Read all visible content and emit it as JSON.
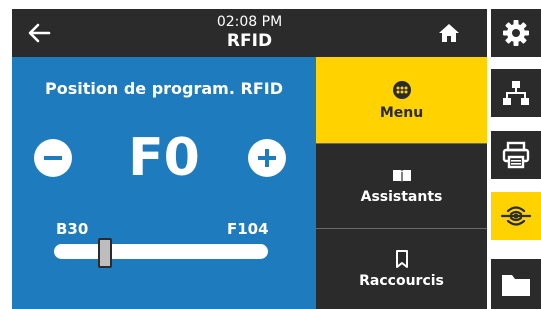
{
  "header": {
    "time": "02:08 PM",
    "title": "RFID"
  },
  "panel": {
    "title": "Position de program. RFID",
    "value": "F0",
    "range_min": "B30",
    "range_max": "F104",
    "slider_fraction": 0.24
  },
  "menu": {
    "items": [
      {
        "label": "Menu",
        "icon": "menu-dots-icon",
        "active": true
      },
      {
        "label": "Assistants",
        "icon": "book-icon",
        "active": false
      },
      {
        "label": "Raccourcis",
        "icon": "bookmark-icon",
        "active": false
      }
    ]
  },
  "rail": {
    "items": [
      {
        "icon": "gear-icon",
        "active": false
      },
      {
        "icon": "network-icon",
        "active": false
      },
      {
        "icon": "printer-icon",
        "active": false
      },
      {
        "icon": "rfid-icon",
        "active": true
      },
      {
        "icon": "folder-icon",
        "active": false
      }
    ]
  },
  "colors": {
    "panel_blue": "#1e7bbd",
    "accent_yellow": "#ffd200",
    "dark": "#2b2b2b"
  }
}
